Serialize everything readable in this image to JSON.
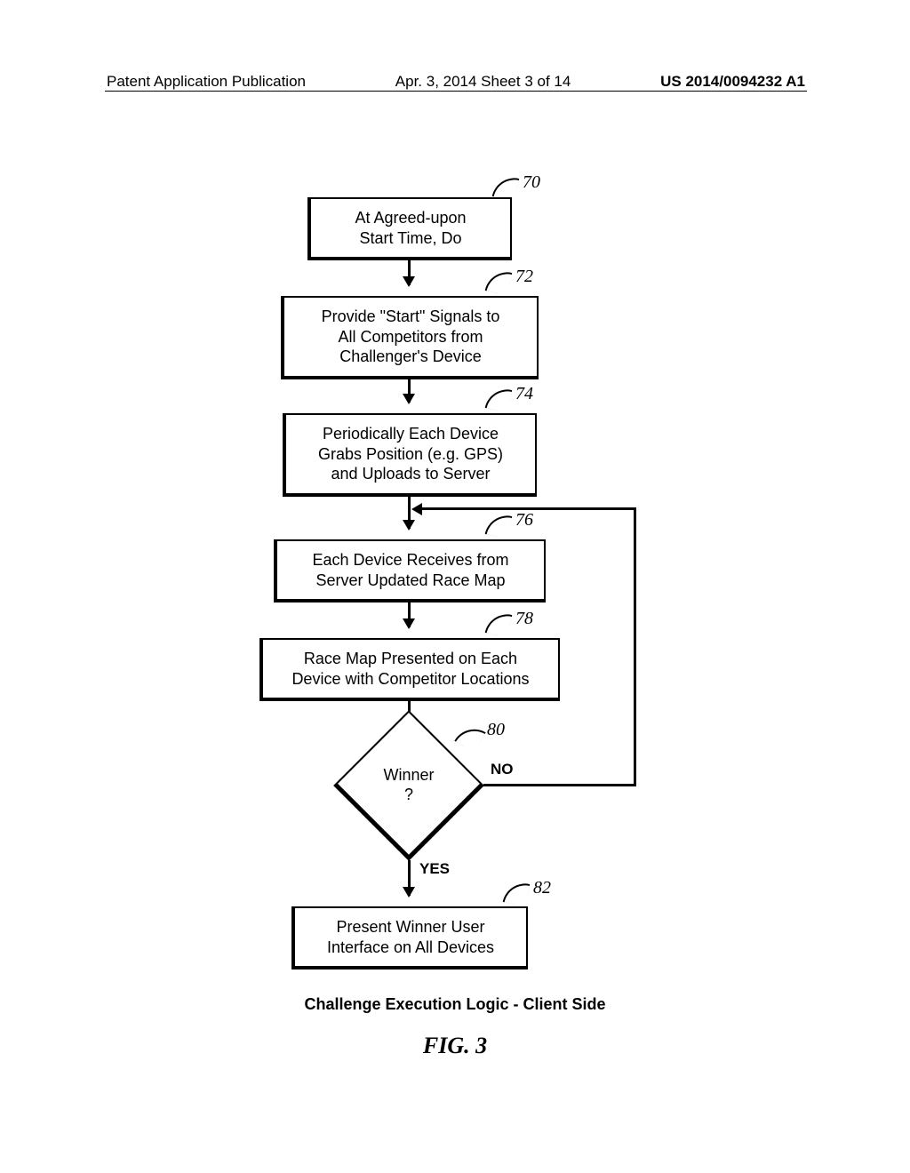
{
  "header": {
    "left": "Patent Application Publication",
    "center": "Apr. 3, 2014  Sheet 3 of 14",
    "right": "US 2014/0094232 A1"
  },
  "boxes": {
    "b70": "At Agreed-upon\nStart Time, Do",
    "b72": "Provide \"Start\" Signals to\nAll Competitors from\nChallenger's Device",
    "b74": "Periodically Each Device\nGrabs Position (e.g. GPS)\nand Uploads to Server",
    "b76": "Each Device Receives from\nServer Updated Race Map",
    "b78": "Race Map Presented on Each\nDevice with Competitor Locations",
    "b82": "Present Winner User\nInterface on All Devices"
  },
  "decision": {
    "text": "Winner\n?",
    "yes": "YES",
    "no": "NO"
  },
  "refs": {
    "r70": "70",
    "r72": "72",
    "r74": "74",
    "r76": "76",
    "r78": "78",
    "r80": "80",
    "r82": "82"
  },
  "caption": "Challenge Execution Logic - Client Side",
  "figure": "FIG. 3",
  "chart_data": {
    "type": "flowchart",
    "title": "Challenge Execution Logic - Client Side",
    "figure_label": "FIG. 3",
    "nodes": [
      {
        "id": "70",
        "kind": "process",
        "label": "At Agreed-upon Start Time, Do"
      },
      {
        "id": "72",
        "kind": "process",
        "label": "Provide \"Start\" Signals to All Competitors from Challenger's Device"
      },
      {
        "id": "74",
        "kind": "process",
        "label": "Periodically Each Device Grabs Position (e.g. GPS) and Uploads to Server"
      },
      {
        "id": "76",
        "kind": "process",
        "label": "Each Device Receives from Server Updated Race Map"
      },
      {
        "id": "78",
        "kind": "process",
        "label": "Race Map Presented on Each Device with Competitor Locations"
      },
      {
        "id": "80",
        "kind": "decision",
        "label": "Winner ?"
      },
      {
        "id": "82",
        "kind": "process",
        "label": "Present Winner User Interface on All Devices"
      }
    ],
    "edges": [
      {
        "from": "70",
        "to": "72"
      },
      {
        "from": "72",
        "to": "74"
      },
      {
        "from": "74",
        "to": "76"
      },
      {
        "from": "76",
        "to": "78"
      },
      {
        "from": "78",
        "to": "80"
      },
      {
        "from": "80",
        "to": "82",
        "label": "YES"
      },
      {
        "from": "80",
        "to": "74",
        "label": "NO",
        "note": "loop back to just before node 76 (re-enter update cycle)"
      }
    ]
  }
}
